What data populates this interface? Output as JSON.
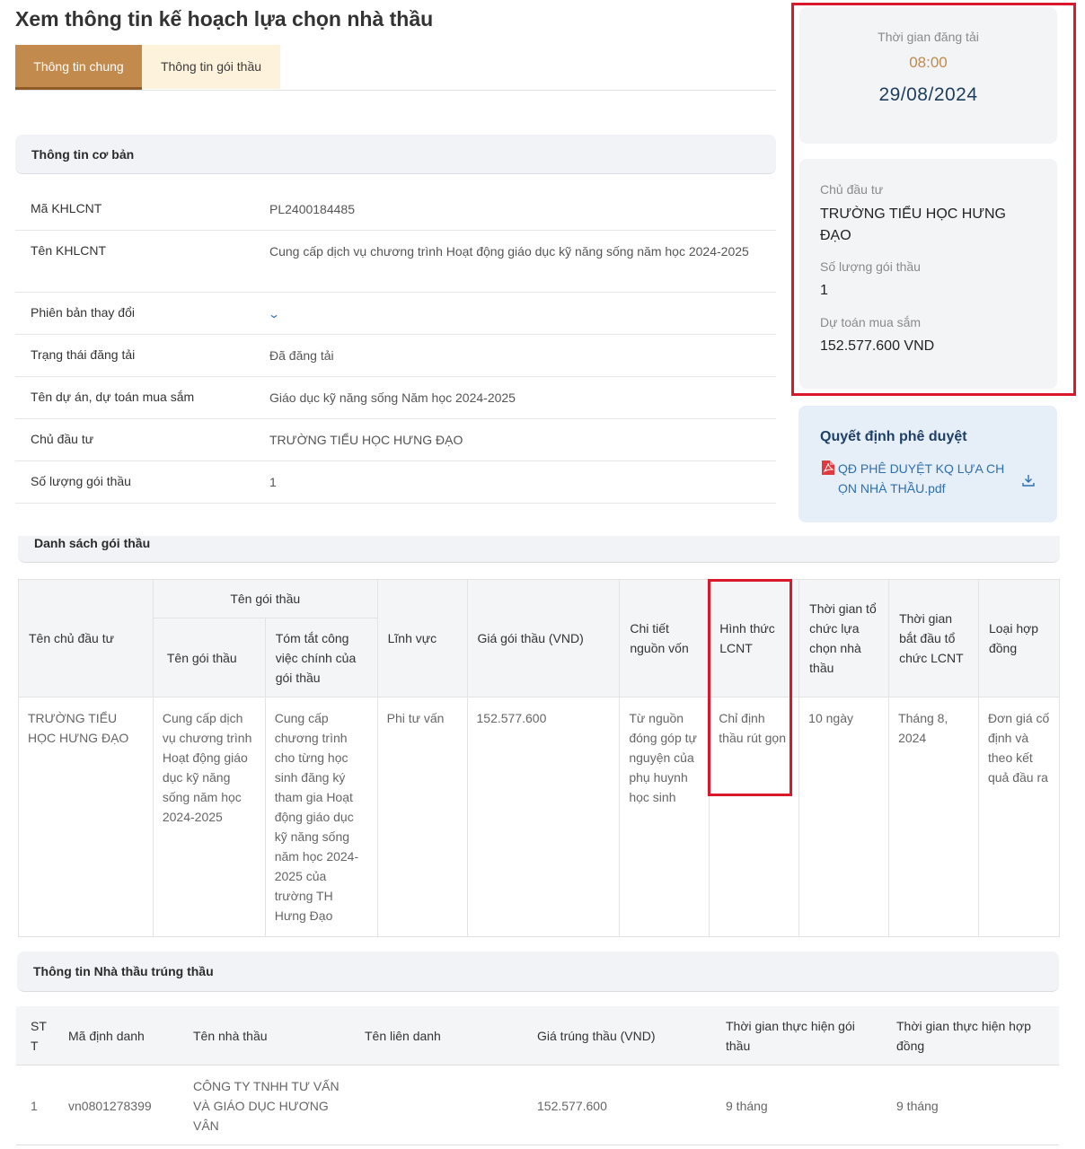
{
  "page": {
    "title": "Xem thông tin kế hoạch lựa chọn nhà thầu"
  },
  "tabs": [
    {
      "label": "Thông tin chung",
      "active": true
    },
    {
      "label": "Thông tin gói thầu",
      "active": false
    }
  ],
  "basic_info": {
    "heading": "Thông tin cơ bản",
    "rows": [
      {
        "label": "Mã KHLCNT",
        "value": "PL2400184485"
      },
      {
        "label": "Tên KHLCNT",
        "value": "Cung cấp dịch vụ chương trình Hoạt động giáo dục kỹ năng sống năm học 2024-2025"
      },
      {
        "label": "Phiên bản thay đổi",
        "value": ""
      },
      {
        "label": "Trạng thái đăng tải",
        "value": "Đã đăng tải"
      },
      {
        "label": "Tên dự án, dự toán mua sắm",
        "value": "Giáo dục kỹ năng sống Năm học 2024-2025"
      },
      {
        "label": "Chủ đầu tư",
        "value": "TRƯỜNG TIỂU HỌC HƯNG ĐẠO"
      },
      {
        "label": "Số lượng gói thầu",
        "value": "1"
      }
    ]
  },
  "side": {
    "posted_label": "Thời gian đăng tải",
    "posted_time": "08:00",
    "posted_date": "29/08/2024",
    "investor_label": "Chủ đầu tư",
    "investor_value": "TRƯỜNG TIỂU HỌC HƯNG ĐẠO",
    "count_label": "Số lượng gói thầu",
    "count_value": "1",
    "budget_label": "Dự toán mua sắm",
    "budget_value": "152.577.600 VND",
    "decision_title": "Quyết định phê duyệt",
    "decision_file": "QĐ PHÊ DUYỆT KQ LỰA CHỌN NHÀ THẦU.pdf",
    "decision_file_line1": "QĐ PHÊ DUYỆT KQ LỰA CH",
    "decision_file_line2": "ỌN NHÀ THẦU.pdf",
    "pdf_icon": "pdf-file-icon",
    "download_icon": "download-icon"
  },
  "packages": {
    "heading": "Danh sách gói thầu",
    "headers": {
      "investor": "Tên chủ đầu tư",
      "package_group": "Tên gói thầu",
      "package_name": "Tên gói thầu",
      "summary": "Tóm tắt công việc chính của gói thầu",
      "field": "Lĩnh vực",
      "price": "Giá gói thầu (VND)",
      "source": "Chi tiết nguồn vốn",
      "method": "Hình thức LCNT",
      "duration": "Thời gian tổ chức lựa chọn nhà thầu",
      "start": "Thời gian bắt đầu tổ chức LCNT",
      "contract": "Loại hợp đồng"
    },
    "row": {
      "investor": "TRƯỜNG TIỂU HỌC HƯNG ĐẠO",
      "package_name": "Cung cấp dịch vụ chương trình Hoạt động giáo dục kỹ năng sống năm học 2024-2025",
      "summary": "Cung cấp chương trình cho từng học sinh đăng ký tham gia Hoạt động giáo dục kỹ năng sống năm học 2024-2025 của trường TH Hưng Đạo",
      "field": "Phi tư vấn",
      "price": "152.577.600",
      "source": "Từ nguồn đóng góp tự nguyện của phụ huynh học sinh",
      "method": "Chỉ định thầu rút gọn",
      "duration": "10 ngày",
      "start": "Tháng 8, 2024",
      "contract": "Đơn giá cố định và theo kết quả đầu ra"
    }
  },
  "winner": {
    "heading": "Thông tin Nhà thầu trúng thầu",
    "headers": {
      "stt": "STT",
      "id": "Mã định danh",
      "name": "Tên nhà thầu",
      "joint": "Tên liên danh",
      "price": "Giá trúng thầu (VND)",
      "pkg_time": "Thời gian thực hiện gói thầu",
      "contract_time": "Thời gian thực hiện hợp đồng"
    },
    "row": {
      "stt": "1",
      "id": "vn0801278399",
      "name": "CÔNG TY TNHH TƯ VẤN VÀ GIÁO DỤC HƯƠNG VÂN",
      "joint": "",
      "price": "152.577.600",
      "pkg_time": "9 tháng",
      "contract_time": "9 tháng"
    }
  }
}
